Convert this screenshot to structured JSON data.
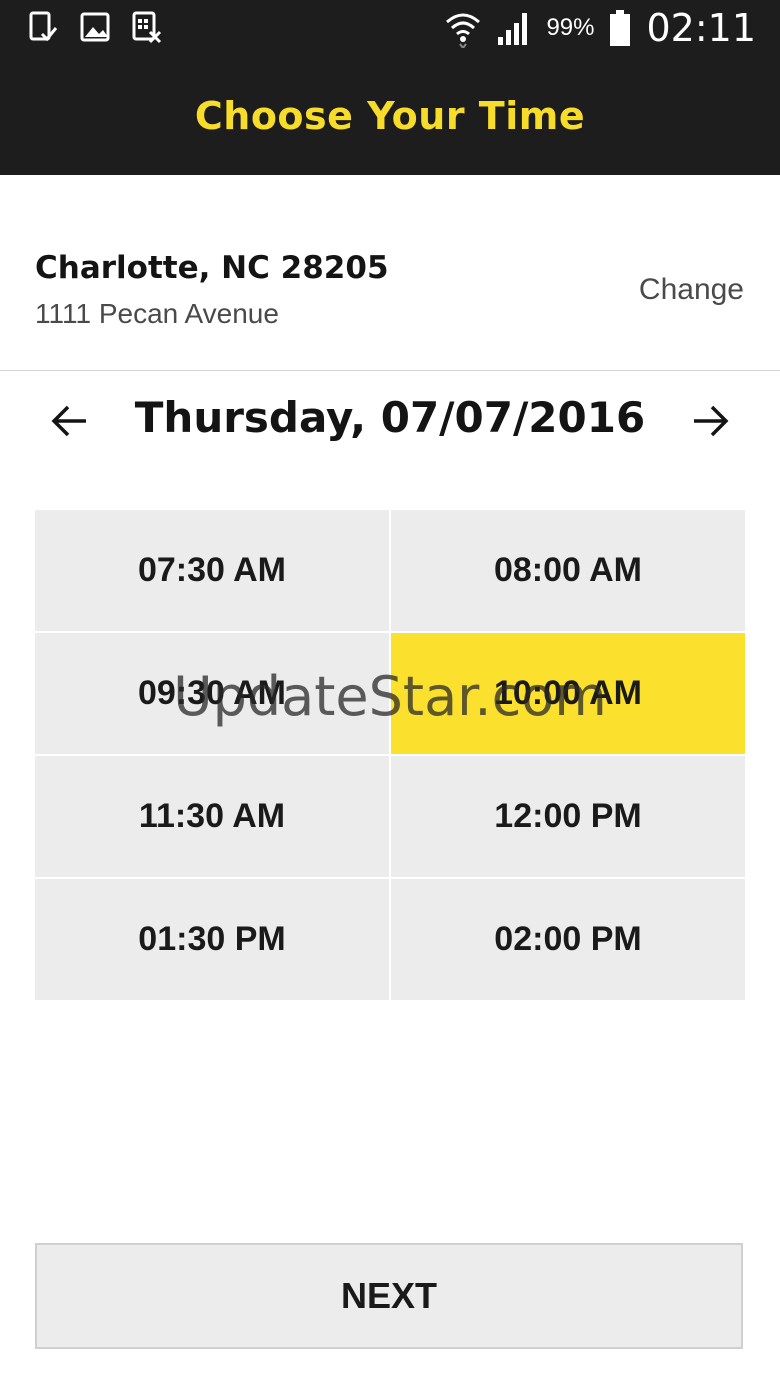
{
  "status_bar": {
    "icons": [
      "tablet-check-icon",
      "image-icon",
      "calendar-x-icon",
      "wifi-icon",
      "signal-icon",
      "battery-icon"
    ],
    "battery": "99%",
    "time": "02:11"
  },
  "header": {
    "title": "Choose Your Time"
  },
  "location": {
    "city": "Charlotte, NC 28205",
    "address": "1111 Pecan Avenue",
    "change_label": "Change"
  },
  "date_nav": {
    "date": "Thursday, 07/07/2016",
    "prev_icon": "arrow-left-icon",
    "next_icon": "arrow-right-icon"
  },
  "slots": [
    {
      "time": "07:30 AM",
      "selected": false
    },
    {
      "time": "08:00 AM",
      "selected": false
    },
    {
      "time": "09:30 AM",
      "selected": false
    },
    {
      "time": "10:00 AM",
      "selected": true
    },
    {
      "time": "11:30 AM",
      "selected": false
    },
    {
      "time": "12:00 PM",
      "selected": false
    },
    {
      "time": "01:30 PM",
      "selected": false
    },
    {
      "time": "02:00 PM",
      "selected": false
    }
  ],
  "watermark": "UpdateStar.com",
  "next_button": {
    "label": "NEXT"
  },
  "colors": {
    "accent": "#fbe12d",
    "title": "#f7dc2a",
    "bar": "#1d1d1d",
    "slot": "#ececec"
  }
}
